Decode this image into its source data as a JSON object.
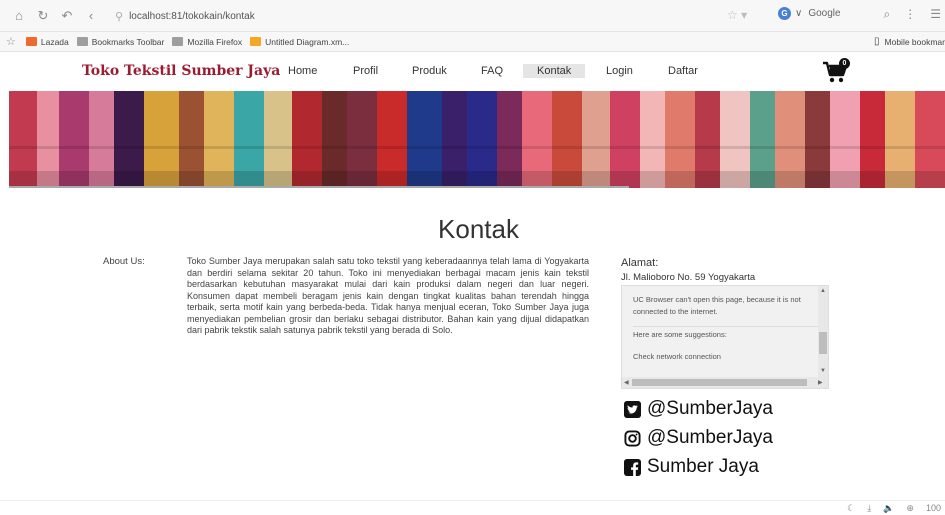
{
  "browser": {
    "url": "localhost:81/tokokain/kontak",
    "search_engine": "Google",
    "bookmarks": [
      "Lazada",
      "Bookmarks Toolbar",
      "Mozilla Firefox",
      "Untitled Diagram.xm..."
    ],
    "mobile_bookmarks": "Mobile bookmar",
    "zoom": "100"
  },
  "site": {
    "brand": "Toko Tekstil Sumber Jaya",
    "menu": [
      "Home",
      "Profil",
      "Produk",
      "FAQ",
      "Kontak",
      "Login",
      "Daftar"
    ],
    "active_menu": "Kontak",
    "cart_count": "0"
  },
  "content": {
    "title": "Kontak",
    "about_label": "About Us:",
    "about_text": "Toko Sumber Jaya merupakan salah satu toko tekstil yang keberadaannya telah lama di Yogyakarta dan berdiri selama sekitar 20 tahun. Toko ini menyediakan berbagai macam jenis kain tekstil berdasarkan kebutuhan masyarakat mulai dari kain produksi dalam negeri dan luar negeri. Konsumen dapat membeli beragam jenis kain dengan tingkat kualitas bahan terendah hingga terbaik, serta motif kain yang berbeda-beda. Tidak hanya menjual eceran, Toko Sumber Jaya juga menyediakan pembelian grosir dan berlaku sebagai distributor. Bahan kain yang dijual didapatkan dari pabrik tekstik salah satunya pabrik tekstil yang berada di Solo.",
    "address_title": "Alamat:",
    "address": "Jl. Malioboro No. 59 Yogyakarta",
    "map_error": "UC Browser can't open this page, because it is not connected to the internet.",
    "map_suggestions": "Here are some suggestions:",
    "map_check": "Check network connection",
    "social": {
      "twitter": "@SumberJaya",
      "instagram": "@SumberJaya",
      "facebook": "Sumber Jaya"
    }
  },
  "colors": {
    "brand": "#9b1b30",
    "active_menu_bg": "#e5e5e5"
  }
}
